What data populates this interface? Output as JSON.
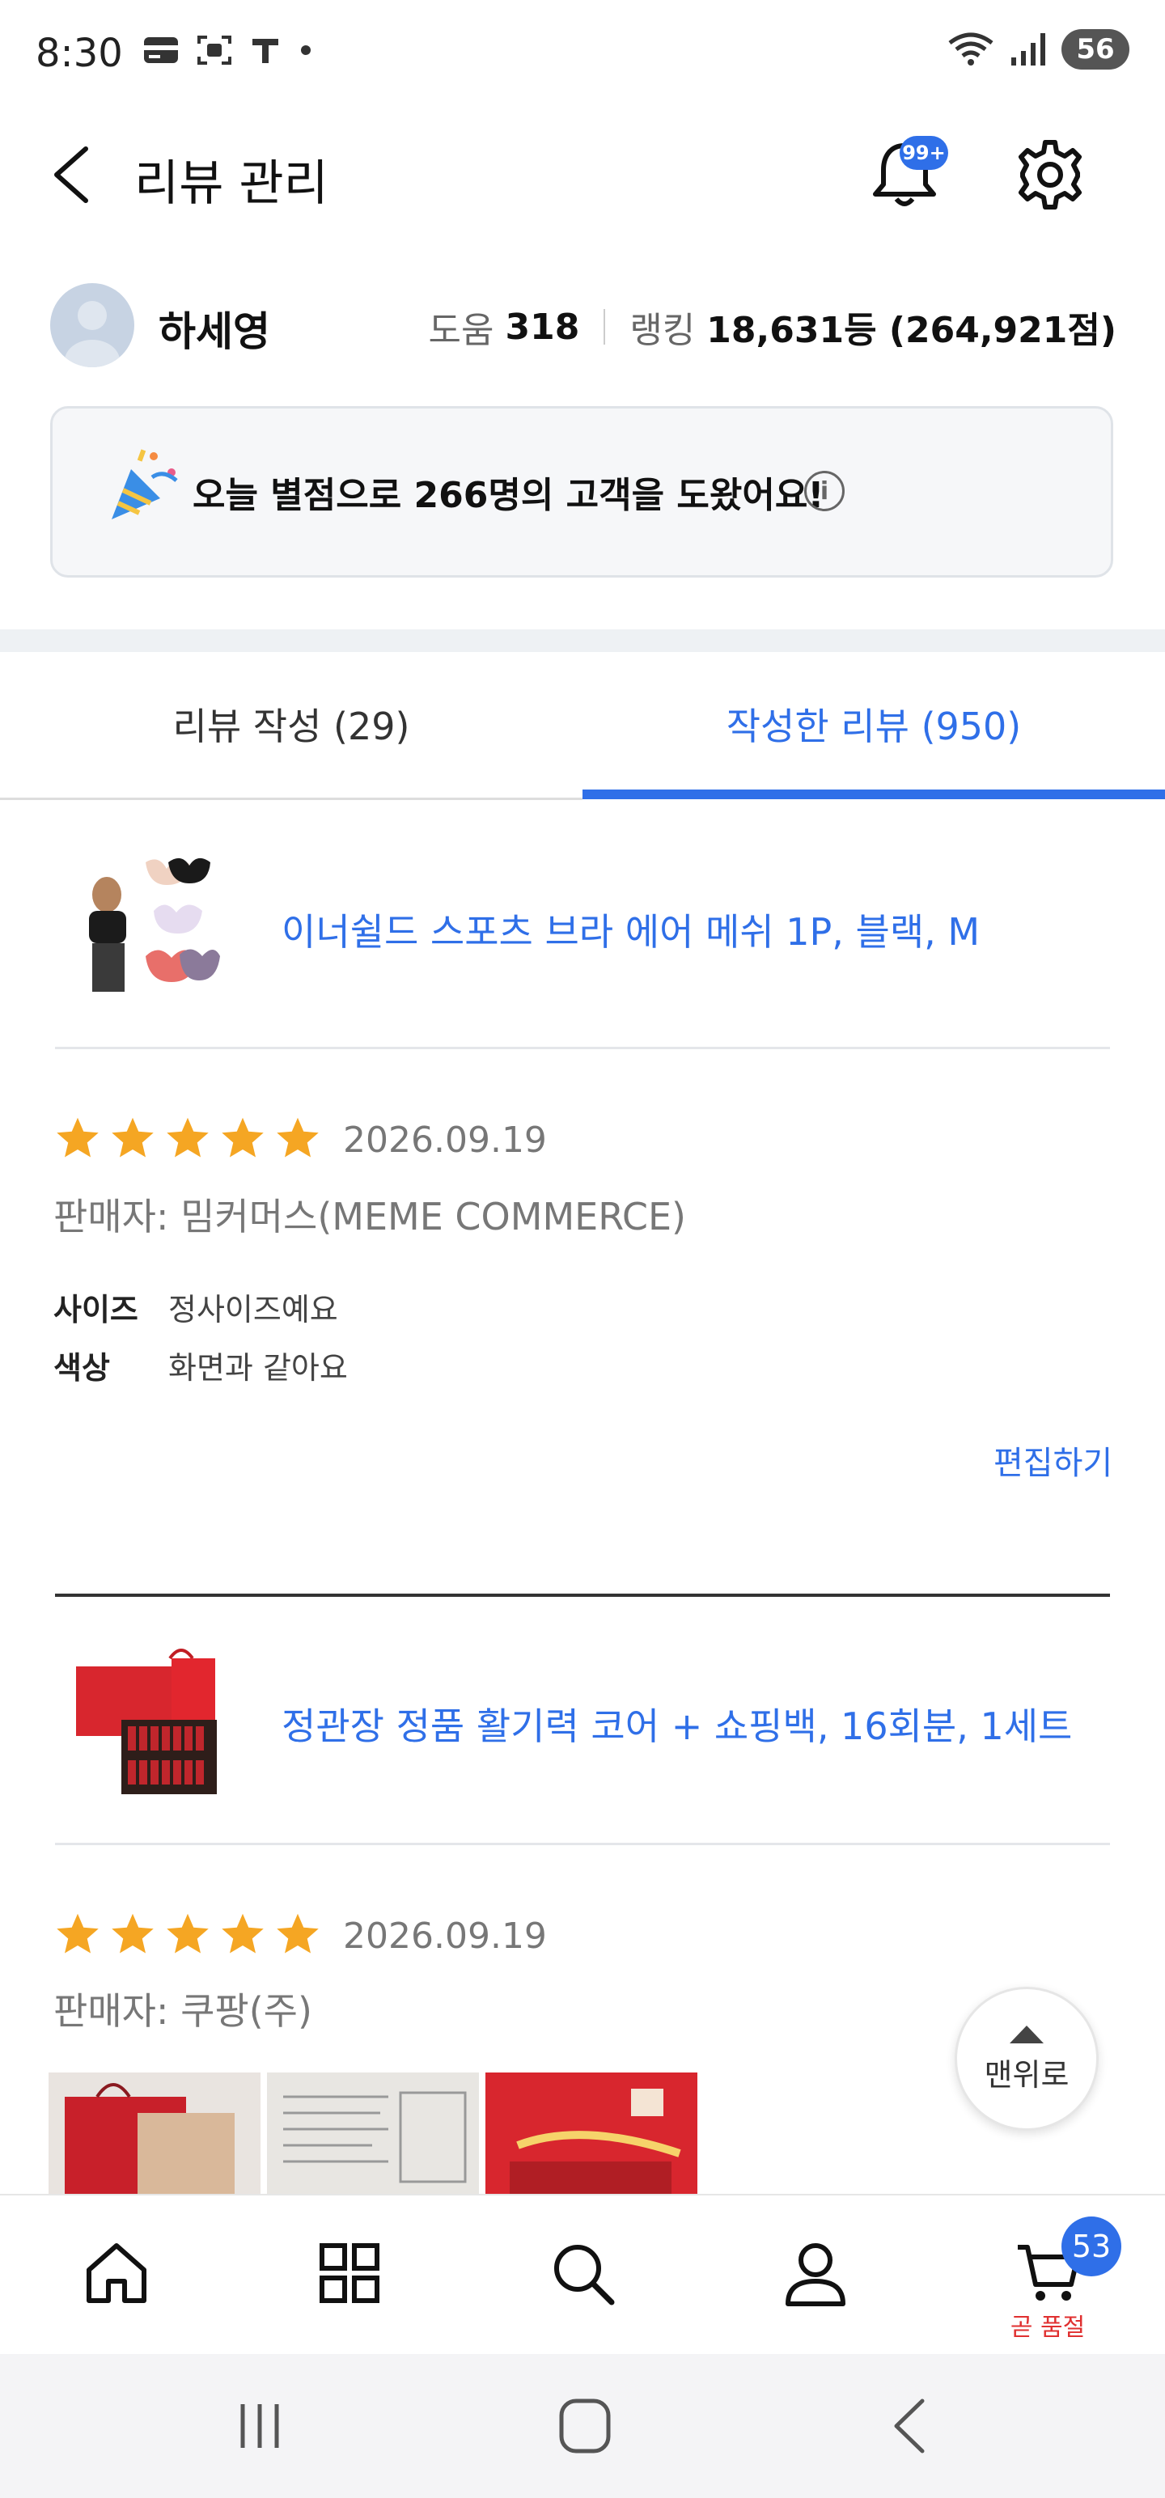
{
  "status_bar": {
    "time": "8:30",
    "battery": "56"
  },
  "header": {
    "title": "리뷰 관리",
    "notification_badge": "99+"
  },
  "profile": {
    "name": "하세영",
    "help_label": "도움",
    "help_value": "318",
    "rank_label": "랭킹",
    "rank_value": "18,631등 (264,921점)"
  },
  "banner": {
    "text": "오늘 별점으로 266명의 고객을 도왔어요!"
  },
  "tabs": [
    {
      "label": "리뷰 작성 (29)",
      "active": false
    },
    {
      "label": "작성한 리뷰 (950)",
      "active": true
    }
  ],
  "reviews": [
    {
      "product": "이너쉴드 스포츠 브라 에어 메쉬 1P, 블랙, M",
      "rating": 5,
      "date": "2026.09.19",
      "seller": "판매자: 밈커머스(MEME COMMERCE)",
      "attributes": [
        {
          "key": "사이즈",
          "value": "정사이즈예요"
        },
        {
          "key": "색상",
          "value": "화면과 같아요"
        }
      ],
      "edit_label": "편집하기"
    },
    {
      "product": "정관장 정품 활기력 코어 + 쇼핑백, 16회분, 1세트",
      "rating": 5,
      "date": "2026.09.19",
      "seller": "판매자: 쿠팡(주)"
    }
  ],
  "top_button": {
    "label": "맨위로"
  },
  "bottom_nav": {
    "items": [
      "home-icon",
      "category-icon",
      "search-icon",
      "profile-icon",
      "cart-icon"
    ],
    "cart_badge": "53",
    "cart_label": "곧 품절"
  },
  "colors": {
    "accent": "#2f6fe8",
    "star": "#f5a623",
    "badge_red": "#e03030"
  }
}
